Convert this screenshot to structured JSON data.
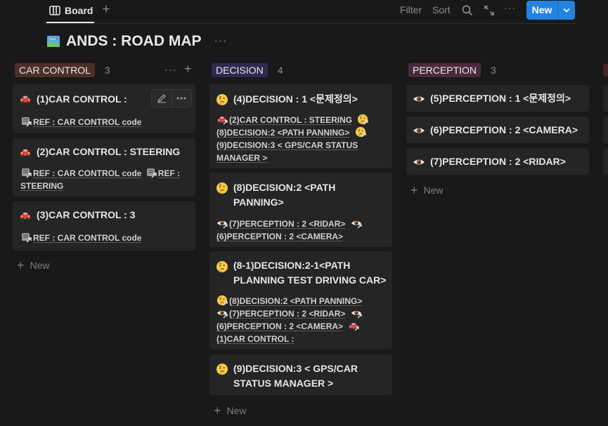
{
  "toolbar": {
    "view_label": "Board",
    "add_view_glyph": "+",
    "filter_label": "Filter",
    "sort_label": "Sort",
    "more_glyph": "···",
    "new_label": "New"
  },
  "page": {
    "icon": "map-icon",
    "title": "ANDS : ROAD MAP",
    "more_glyph": "···"
  },
  "colors": {
    "accent": "#2383e2",
    "car_control_tag": "#4c2f27",
    "decision_tag": "#2e2a4f",
    "perception_tag": "#4a2a3c",
    "card_bg": "#252525",
    "page_bg": "#191919"
  },
  "columns": [
    {
      "name": "CAR CONTROL",
      "count": "3",
      "actions": {
        "more": "···",
        "add": "+"
      },
      "add_label": "New",
      "cards": [
        {
          "icon": "car-icon",
          "title": "(1)CAR CONTROL :",
          "relations": [
            "REF : CAR CONTROL code"
          ]
        },
        {
          "icon": "car-icon",
          "title": "(2)CAR CONTROL : STEERING",
          "relations": [
            "REF : CAR CONTROL code",
            "REF :",
            "STEERING"
          ]
        },
        {
          "icon": "car-icon",
          "title": "(3)CAR CONTROL : 3",
          "relations": [
            "REF : CAR CONTROL code"
          ]
        }
      ]
    },
    {
      "name": "DECISION",
      "count": "4",
      "add_label": "New",
      "cards": [
        {
          "icon": "thinking-icon",
          "title": "(4)DECISION : 1 <문제정의>",
          "relations": [
            "(2)CAR CONTROL : STEERING",
            "(8)DECISION:2 <PATH PANNING>",
            "(9)DECISION:3 < GPS/CAR STATUS",
            "MANAGER >"
          ]
        },
        {
          "icon": "thinking-icon",
          "title_lines": [
            "(8)DECISION:2 <PATH",
            "PANNING>"
          ],
          "relations": [
            "(7)PERCEPTION : 2 <RIDAR>",
            "(6)PERCEPTION : 2 <CAMERA>"
          ]
        },
        {
          "icon": "thinking-icon",
          "title_lines": [
            "(8-1)DECISION:2-1<PATH",
            "PLANNING TEST DRIVING CAR>"
          ],
          "relations": [
            "(8)DECISION:2 <PATH PANNING>",
            "(7)PERCEPTION : 2 <RIDAR>",
            "(6)PERCEPTION : 2 <CAMERA>",
            "(1)CAR CONTROL :"
          ]
        },
        {
          "icon": "thinking-icon",
          "title_lines": [
            "(9)DECISION:3 < GPS/CAR",
            "STATUS MANAGER >"
          ],
          "relations": []
        }
      ]
    },
    {
      "name": "PERCEPTION",
      "count": "3",
      "add_label": "New",
      "cards": [
        {
          "icon": "eye-icon",
          "title": "(5)PERCEPTION : 1 <문제정의>"
        },
        {
          "icon": "eye-icon",
          "title": "(6)PERCEPTION : 2 <CAMERA>"
        },
        {
          "icon": "eye-icon",
          "title": "(7)PERCEPTION : 2 <RIDAR>"
        }
      ]
    }
  ]
}
